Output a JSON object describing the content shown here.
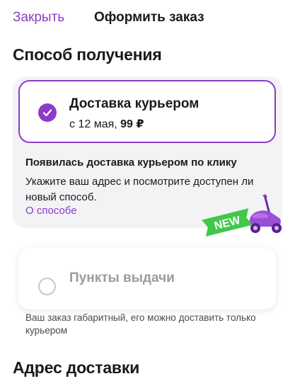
{
  "header": {
    "close_label": "Закрыть",
    "title": "Оформить заказ"
  },
  "receiving": {
    "title": "Способ получения",
    "courier": {
      "title": "Доставка курьером",
      "date": "с 12 мая,",
      "price": "99 ₽",
      "selected": true
    },
    "promo": {
      "title": "Появилась доставка курьером по клику",
      "text": "Укажите ваш адрес и посмотрите доступен ли новый способ.",
      "link": "О способе",
      "badge": "NEW"
    },
    "pickup": {
      "title": "Пункты выдачи",
      "selected": false,
      "note": "Ваш заказ габаритный, его можно доставить только курьером"
    }
  },
  "address": {
    "title": "Адрес доставки"
  },
  "colors": {
    "accent": "#8a3cc9",
    "badge_green": "#3fc84a"
  }
}
